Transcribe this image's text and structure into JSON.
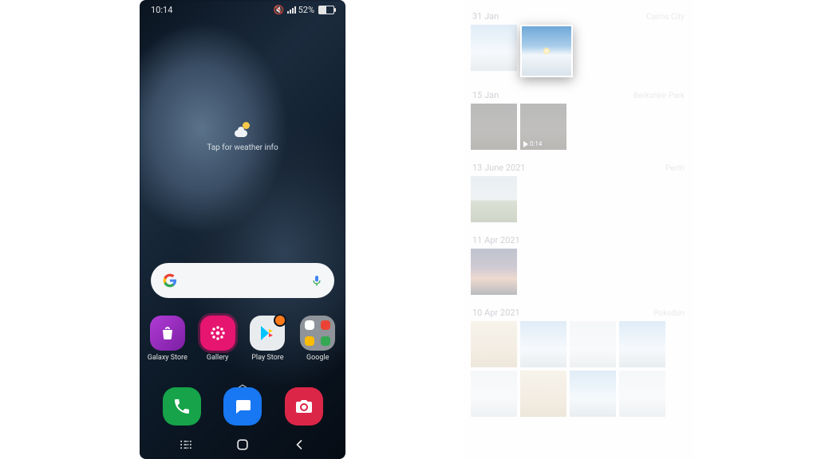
{
  "status": {
    "time": "10:14",
    "battery_pct": "52%"
  },
  "weather": {
    "label": "Tap for weather info"
  },
  "dock": {
    "apps": [
      {
        "label": "Galaxy Store"
      },
      {
        "label": "Gallery"
      },
      {
        "label": "Play Store"
      },
      {
        "label": "Google"
      }
    ]
  },
  "gallery": {
    "sections": [
      {
        "date": "31 Jan",
        "location": "Cairns City"
      },
      {
        "date": "15 Jan",
        "location": "Berkshire Park",
        "video_duration": "0:14"
      },
      {
        "date": "13 June 2021",
        "location": "Perth"
      },
      {
        "date": "11 Apr 2021",
        "location": ""
      },
      {
        "date": "10 Apr 2021",
        "location": "Pokolbin"
      }
    ]
  }
}
